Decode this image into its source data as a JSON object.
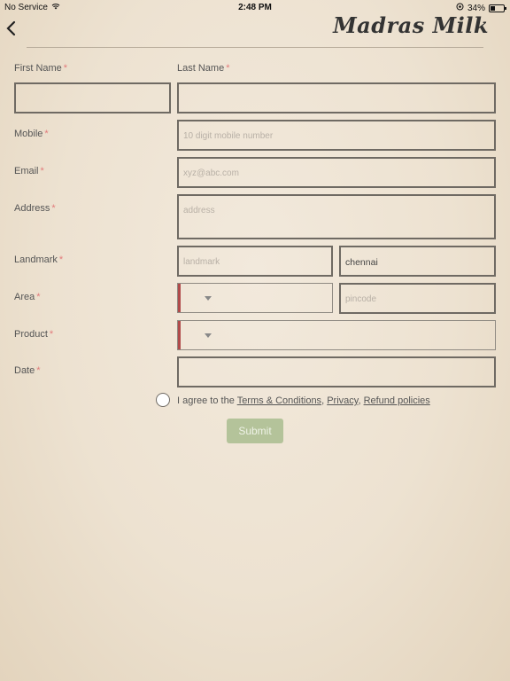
{
  "status_bar": {
    "carrier": "No Service",
    "time": "2:48 PM",
    "battery": "34%"
  },
  "header": {
    "brand": "Madras Milk"
  },
  "form": {
    "first_name_label": "First Name",
    "last_name_label": "Last Name",
    "mobile_label": "Mobile",
    "mobile_placeholder": "10 digit mobile number",
    "email_label": "Email",
    "email_placeholder": "xyz@abc.com",
    "address_label": "Address",
    "address_placeholder": "address",
    "landmark_label": "Landmark",
    "landmark_placeholder": "landmark",
    "city_value": "chennai",
    "area_label": "Area",
    "pincode_placeholder": "pincode",
    "product_label": "Product",
    "date_label": "Date",
    "required_mark": "*"
  },
  "agreement": {
    "prefix": "I agree to the",
    "terms": "Terms & Conditions",
    "sep1": ",",
    "privacy": "Privacy",
    "sep2": ",",
    "refund": "Refund policies"
  },
  "submit_label": "Submit"
}
